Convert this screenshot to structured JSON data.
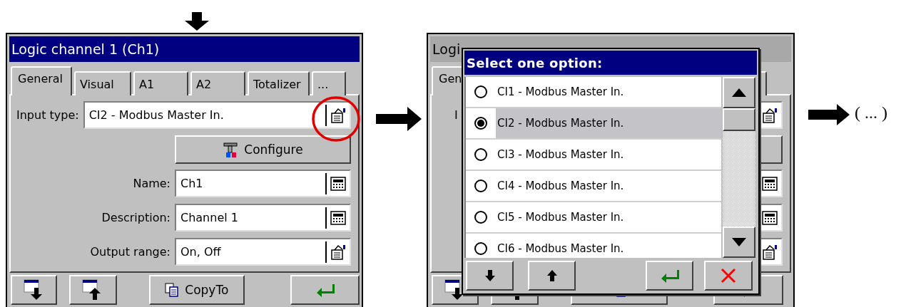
{
  "settings_window": {
    "title": "Logic channel 1 (Ch1)",
    "tabs": [
      {
        "label": "General",
        "selected": true
      },
      {
        "label": "Visual",
        "selected": false
      },
      {
        "label": "A1",
        "selected": false
      },
      {
        "label": "A2",
        "selected": false
      },
      {
        "label": "Totalizer",
        "selected": false
      },
      {
        "label": "...",
        "selected": false
      }
    ],
    "rows": [
      {
        "kind": "select",
        "label": "Input type:",
        "value": "CI2 - Modbus Master In."
      },
      {
        "kind": "button",
        "label": "Configure"
      },
      {
        "kind": "text",
        "label": "Name:",
        "value": "Ch1"
      },
      {
        "kind": "text",
        "label": "Description:",
        "value": "Channel 1"
      },
      {
        "kind": "select",
        "label": "Output range:",
        "value": "On, Off"
      }
    ],
    "toolbar": [
      {
        "kind": "page-down"
      },
      {
        "kind": "page-up"
      },
      {
        "kind": "copy",
        "label": "CopyTo"
      },
      {
        "kind": "enter"
      }
    ]
  },
  "background_window": {
    "title": "Logi",
    "tab": "Gen",
    "input_label": "I"
  },
  "option_dialog": {
    "title": "Select one option:",
    "options": [
      {
        "label": "CI1 - Modbus Master In.",
        "selected": false
      },
      {
        "label": "CI2 - Modbus Master In.",
        "selected": true
      },
      {
        "label": "CI3 - Modbus Master In.",
        "selected": false
      },
      {
        "label": "CI4 - Modbus Master In.",
        "selected": false
      },
      {
        "label": "CI5 - Modbus Master In.",
        "selected": false
      },
      {
        "label": "CI6 - Modbus Master In.",
        "selected": false
      }
    ],
    "buttons": [
      {
        "kind": "page-down"
      },
      {
        "kind": "page-up"
      },
      {
        "kind": "enter"
      },
      {
        "kind": "cancel"
      }
    ]
  },
  "continuation": "( ... )"
}
